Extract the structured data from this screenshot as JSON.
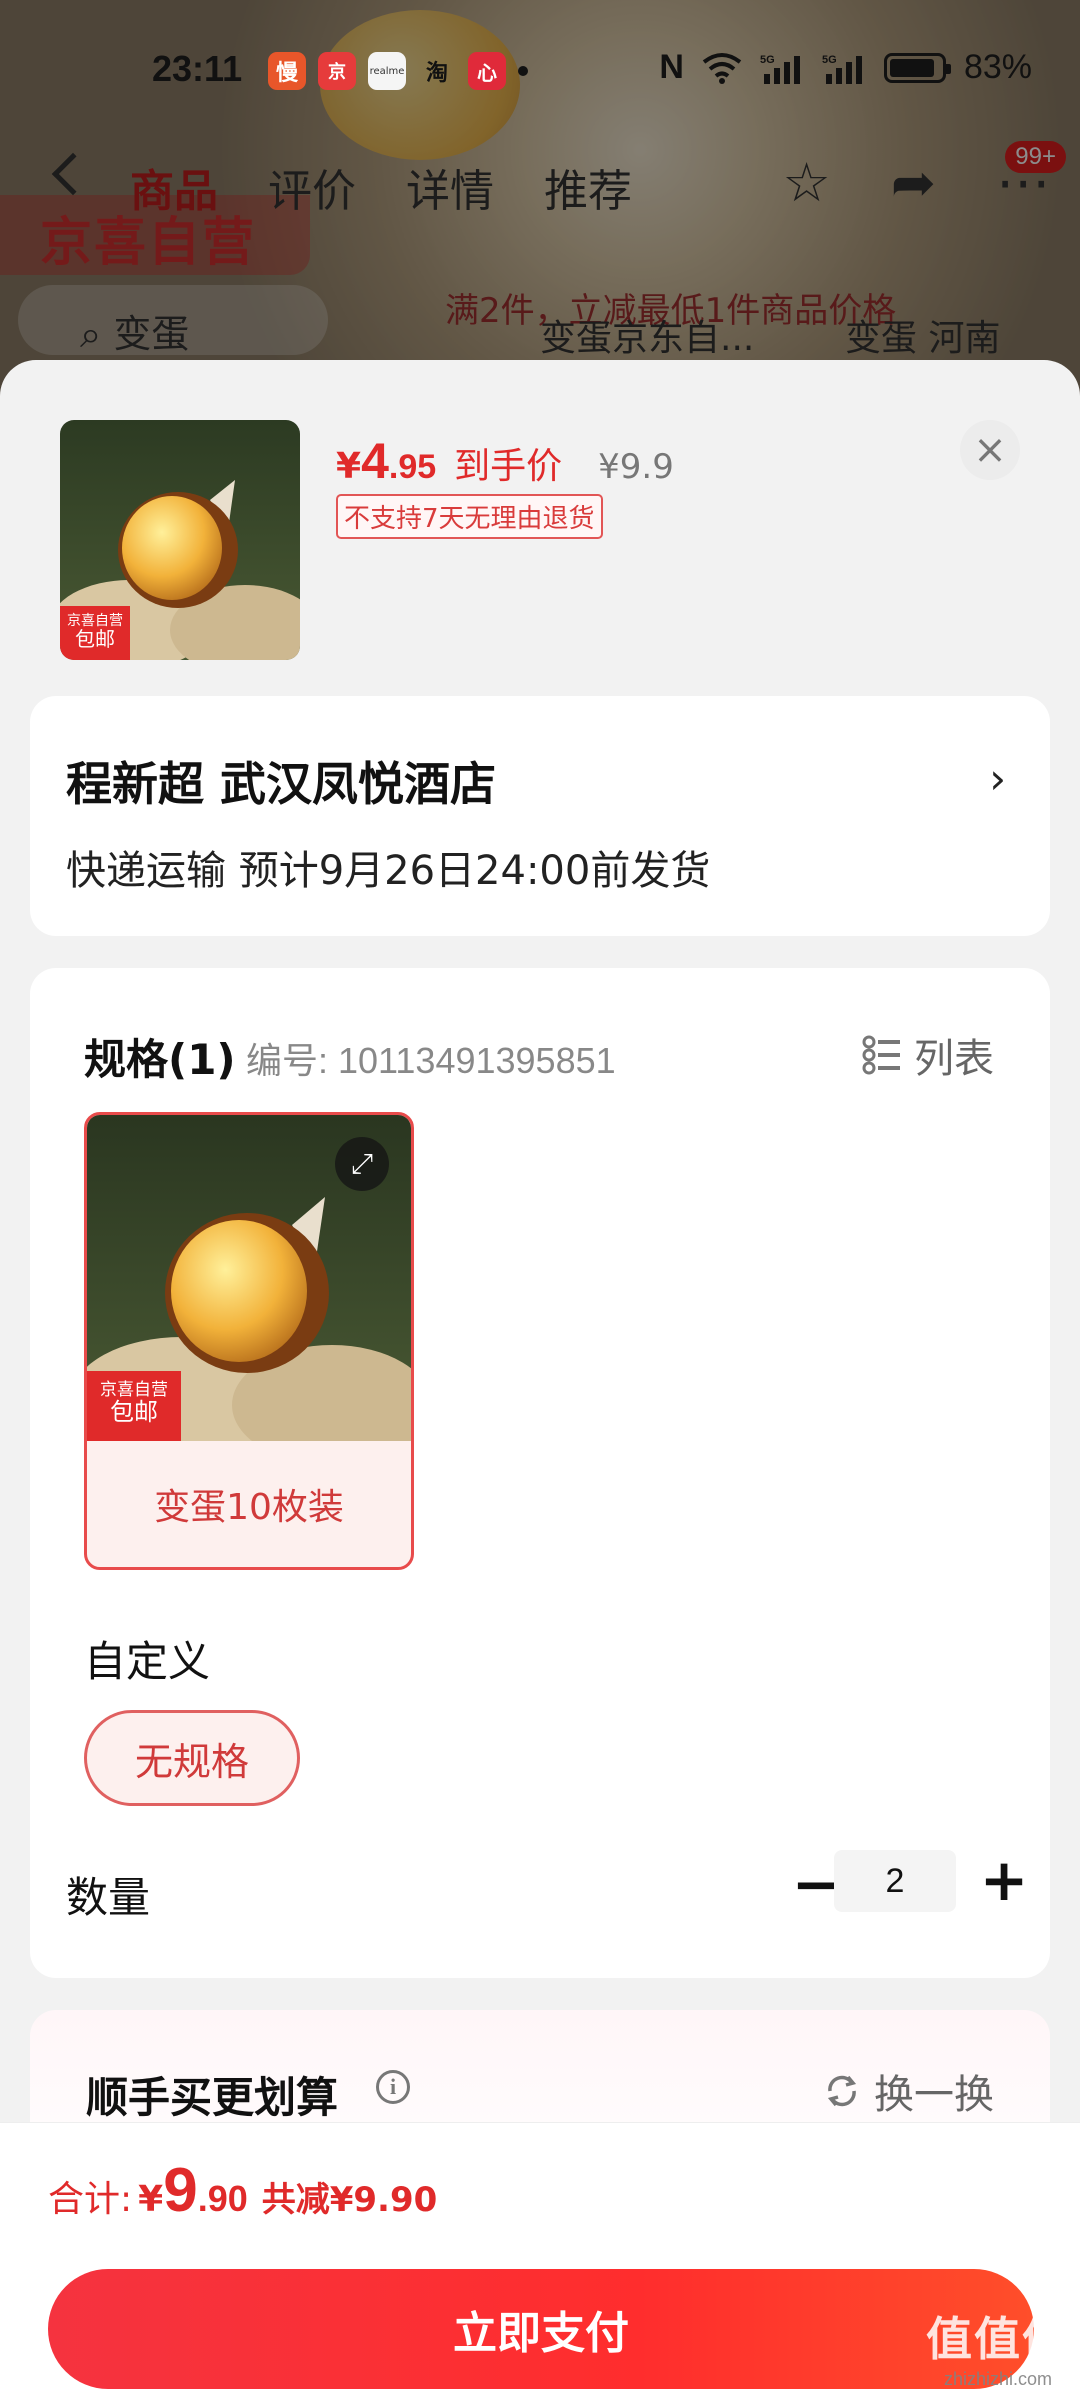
{
  "colors": {
    "accent": "#e02a2a",
    "pay_button": "#ff2d2d",
    "sheet_bg": "#f2f2f2"
  },
  "status_bar": {
    "time": "23:11",
    "apps": [
      "慢",
      "京",
      "realme",
      "淘",
      "心"
    ],
    "battery": "83%",
    "icons": [
      "nfc-icon",
      "wifi-icon",
      "signal-5g-icon",
      "signal-5g-icon",
      "battery-icon"
    ]
  },
  "background_page": {
    "tabs": [
      "商品",
      "评价",
      "详情",
      "推荐"
    ],
    "active_tab": "商品",
    "badge": "99+",
    "logo": "京喜自营",
    "search_text": "变蛋",
    "promo_text": "满2件，立减最低1件商品价格",
    "suggest_1": "变蛋京东自...",
    "suggest_2": "变蛋 河南"
  },
  "product": {
    "price_currency": "¥",
    "price_int": "4",
    "price_dec": ".95",
    "price_label": "到手价",
    "price_original": "¥9.9",
    "return_tag": "不支持7天无理由退货",
    "thumb_badge_top": "京喜自营",
    "thumb_badge_bottom": "包邮"
  },
  "address": {
    "name": "程新超  武汉凤悦酒店",
    "delivery": "快递运输 预计9月26日24:00前发货",
    "arrow": "›"
  },
  "spec": {
    "title": "规格(1)",
    "code": "编号: 10113491395851",
    "list_label": "列表",
    "variant_label": "变蛋10枚装",
    "variant_badge_top": "京喜自营",
    "variant_badge_bottom": "包邮",
    "custom_label": "自定义",
    "no_spec_chip": "无规格",
    "qty_label": "数量",
    "qty_value": "2"
  },
  "bundle": {
    "title": "顺手买更划算",
    "swap_label": "换一换"
  },
  "footer": {
    "total_label": "合计:",
    "total_currency": "¥",
    "total_int": "9",
    "total_dec": ".90",
    "total_off": "共减¥9.90",
    "pay_label": "立即支付"
  },
  "watermark": {
    "glyph": "值值值",
    "text": "zhizhizhi.com"
  }
}
